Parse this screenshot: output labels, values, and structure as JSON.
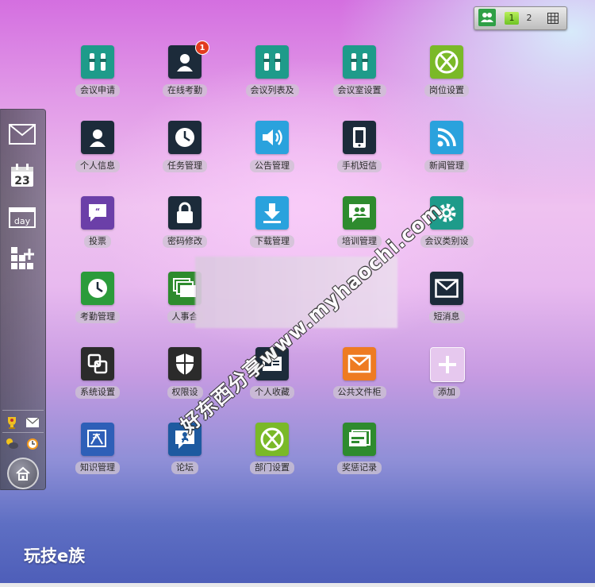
{
  "topbar": {
    "pages": [
      "1",
      "2"
    ],
    "active_page": "1"
  },
  "dock": {
    "items": [
      "mail-icon",
      "calendar-icon",
      "day-view-icon",
      "add-widget-icon"
    ],
    "home": "home-icon"
  },
  "apps": [
    {
      "label": "会议申请",
      "icon": "plug-icon",
      "color": "#1e9b8a"
    },
    {
      "label": "在线考勤",
      "icon": "user-icon",
      "color": "#1c2b3a",
      "badge": "1"
    },
    {
      "label": "会议列表及",
      "icon": "plug-icon",
      "color": "#1e9b8a"
    },
    {
      "label": "会议室设置",
      "icon": "plug-icon",
      "color": "#1e9b8a"
    },
    {
      "label": "岗位设置",
      "icon": "xbox-icon",
      "color": "#7ab928"
    },
    {
      "label": "个人信息",
      "icon": "user-icon",
      "color": "#1c2b3a"
    },
    {
      "label": "任务管理",
      "icon": "clock-icon",
      "color": "#1c2b3a"
    },
    {
      "label": "公告管理",
      "icon": "speaker-icon",
      "color": "#2aa2dd"
    },
    {
      "label": "手机短信",
      "icon": "phone-icon",
      "color": "#1c2b3a"
    },
    {
      "label": "新闻管理",
      "icon": "rss-icon",
      "color": "#2aa2dd"
    },
    {
      "label": "投票",
      "icon": "chat-icon",
      "color": "#6b3fa8"
    },
    {
      "label": "密码修改",
      "icon": "lock-icon",
      "color": "#1c2b3a"
    },
    {
      "label": "下载管理",
      "icon": "download-icon",
      "color": "#2aa2dd"
    },
    {
      "label": "培训管理",
      "icon": "group-chat-icon",
      "color": "#2e8b2e"
    },
    {
      "label": "会议类别设",
      "icon": "gear-icon",
      "color": "#1e9b8a"
    },
    {
      "label": "考勤管理",
      "icon": "clock-icon",
      "color": "#2b9b3b"
    },
    {
      "label": "人事合",
      "icon": "windows-icon",
      "color": "#2e8b2e"
    },
    {
      "label": "短消息",
      "icon": "envelope-icon",
      "color": "#1c2b3a"
    },
    {
      "label": "系统设置",
      "icon": "settings-icon",
      "color": "#2b2b2b"
    },
    {
      "label": "权限设",
      "icon": "shield-icon",
      "color": "#2b2b2b"
    },
    {
      "label": "个人收藏",
      "icon": "card-icon",
      "color": "#1c2b3a"
    },
    {
      "label": "公共文件柜",
      "icon": "mail-open-icon",
      "color": "#ee7b22"
    },
    {
      "label": "添加",
      "icon": "plus-icon",
      "color": "#e6c8ee"
    },
    {
      "label": "知识管理",
      "icon": "book-icon",
      "color": "#2e5fb8"
    },
    {
      "label": "论坛",
      "icon": "person-chat-icon",
      "color": "#1d5aa0"
    },
    {
      "label": "部门设置",
      "icon": "xbox-icon",
      "color": "#7ab928"
    },
    {
      "label": "奖惩记录",
      "icon": "cards-icon",
      "color": "#2e8b2e"
    }
  ],
  "watermark": "好东西分享www.myhaochi.com",
  "brand": "玩技e族"
}
